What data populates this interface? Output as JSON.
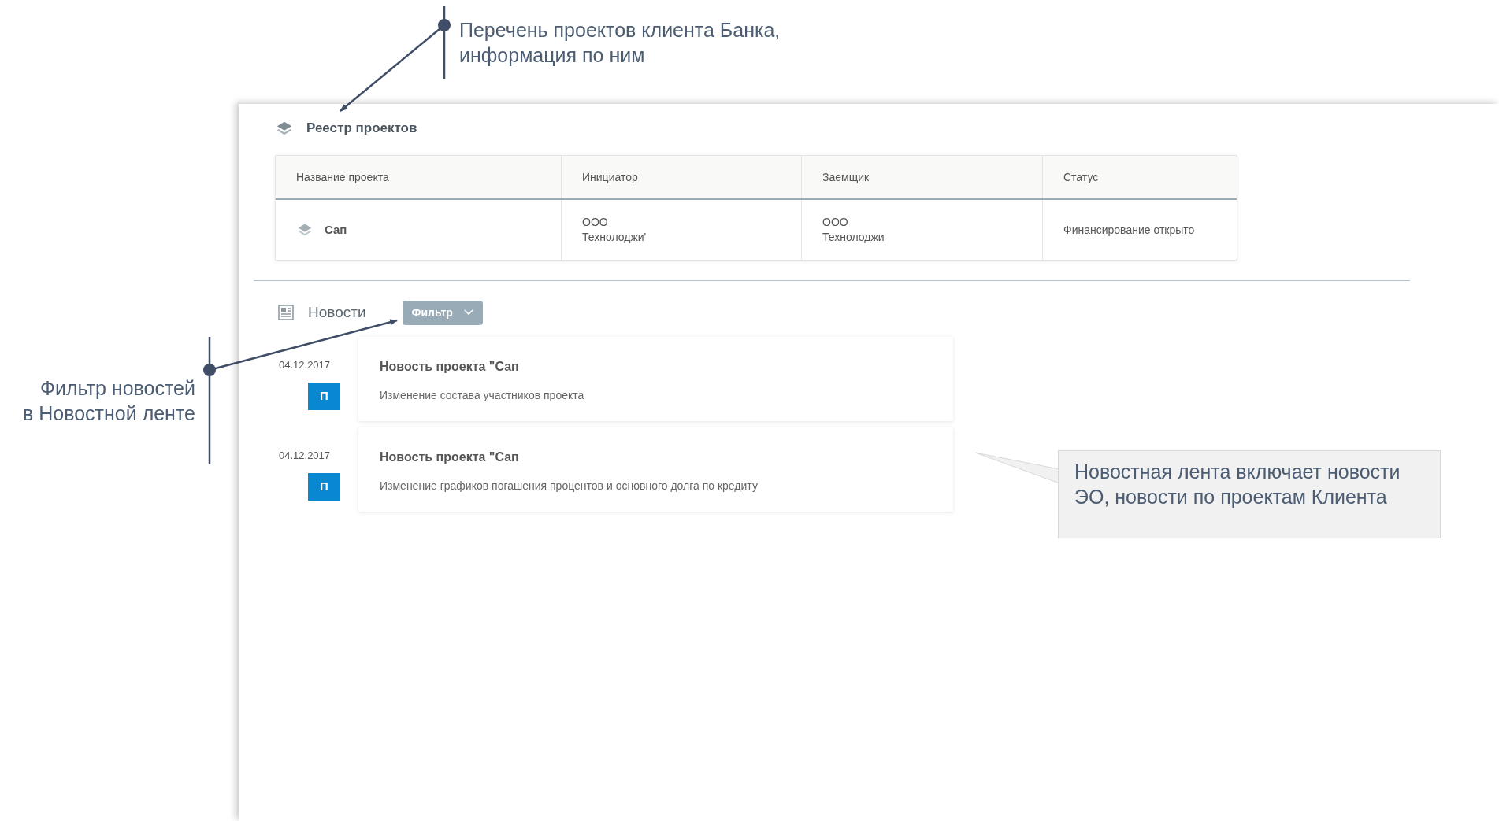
{
  "annotations": {
    "projects_note": [
      "Перечень проектов клиента Банка,",
      "информация по ним"
    ],
    "filter_note": [
      "Фильтр новостей",
      "в Новостной ленте"
    ],
    "feed_note": [
      "Новостная лента включает новости",
      "ЭО, новости по проектам Клиента"
    ]
  },
  "registry": {
    "title": "Реестр проектов",
    "columns": [
      "Название проекта",
      "Инициатор",
      "Заемщик",
      "Статус"
    ],
    "rows": [
      {
        "name": "Сап",
        "initiator": [
          "ООО",
          "Технолоджи'"
        ],
        "borrower": [
          "ООО",
          "Технолоджи"
        ],
        "status": "Финансирование открыто"
      }
    ]
  },
  "news": {
    "title": "Новости",
    "filter_button": "Фильтр",
    "items": [
      {
        "date": "04.12.2017",
        "badge": "П",
        "title": "Новость проекта \"Сап",
        "text": "Изменение состава участников проекта"
      },
      {
        "date": "04.12.2017",
        "badge": "П",
        "title": "Новость проекта \"Сап",
        "text": "Изменение графиков погашения процентов и основного долга по кредиту"
      }
    ]
  }
}
